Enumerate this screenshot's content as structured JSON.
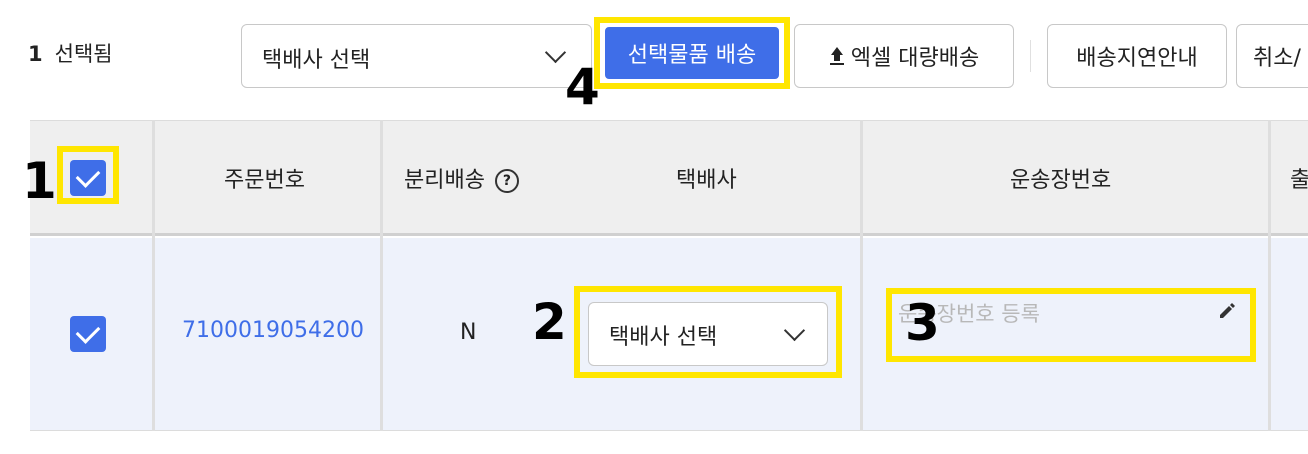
{
  "toolbar": {
    "selected_count": "1",
    "selected_label": "선택됨",
    "carrier_select_value": "택배사 선택",
    "ship_selected_label": "선택물품 배송",
    "excel_bulk_label": "엑셀 대량배송",
    "delay_notice_label": "배송지연안내",
    "cancel_label": "취소/"
  },
  "table": {
    "headers": {
      "order_no": "주문번호",
      "split_shipping": "분리배송",
      "carrier": "택배사",
      "tracking_no": "운송장번호",
      "next_cut": "출"
    },
    "rows": [
      {
        "order_no": "7100019054200",
        "split_shipping": "N",
        "carrier_select_value": "택배사 선택",
        "tracking_placeholder": "운송장번호 등록"
      }
    ]
  },
  "annotations": {
    "n1": "1",
    "n2": "2",
    "n3": "3",
    "n4": "4"
  },
  "colors": {
    "accent": "#3f6ee8",
    "highlight": "#ffe600",
    "row_bg": "#eef2fb",
    "header_bg": "#efefef"
  }
}
